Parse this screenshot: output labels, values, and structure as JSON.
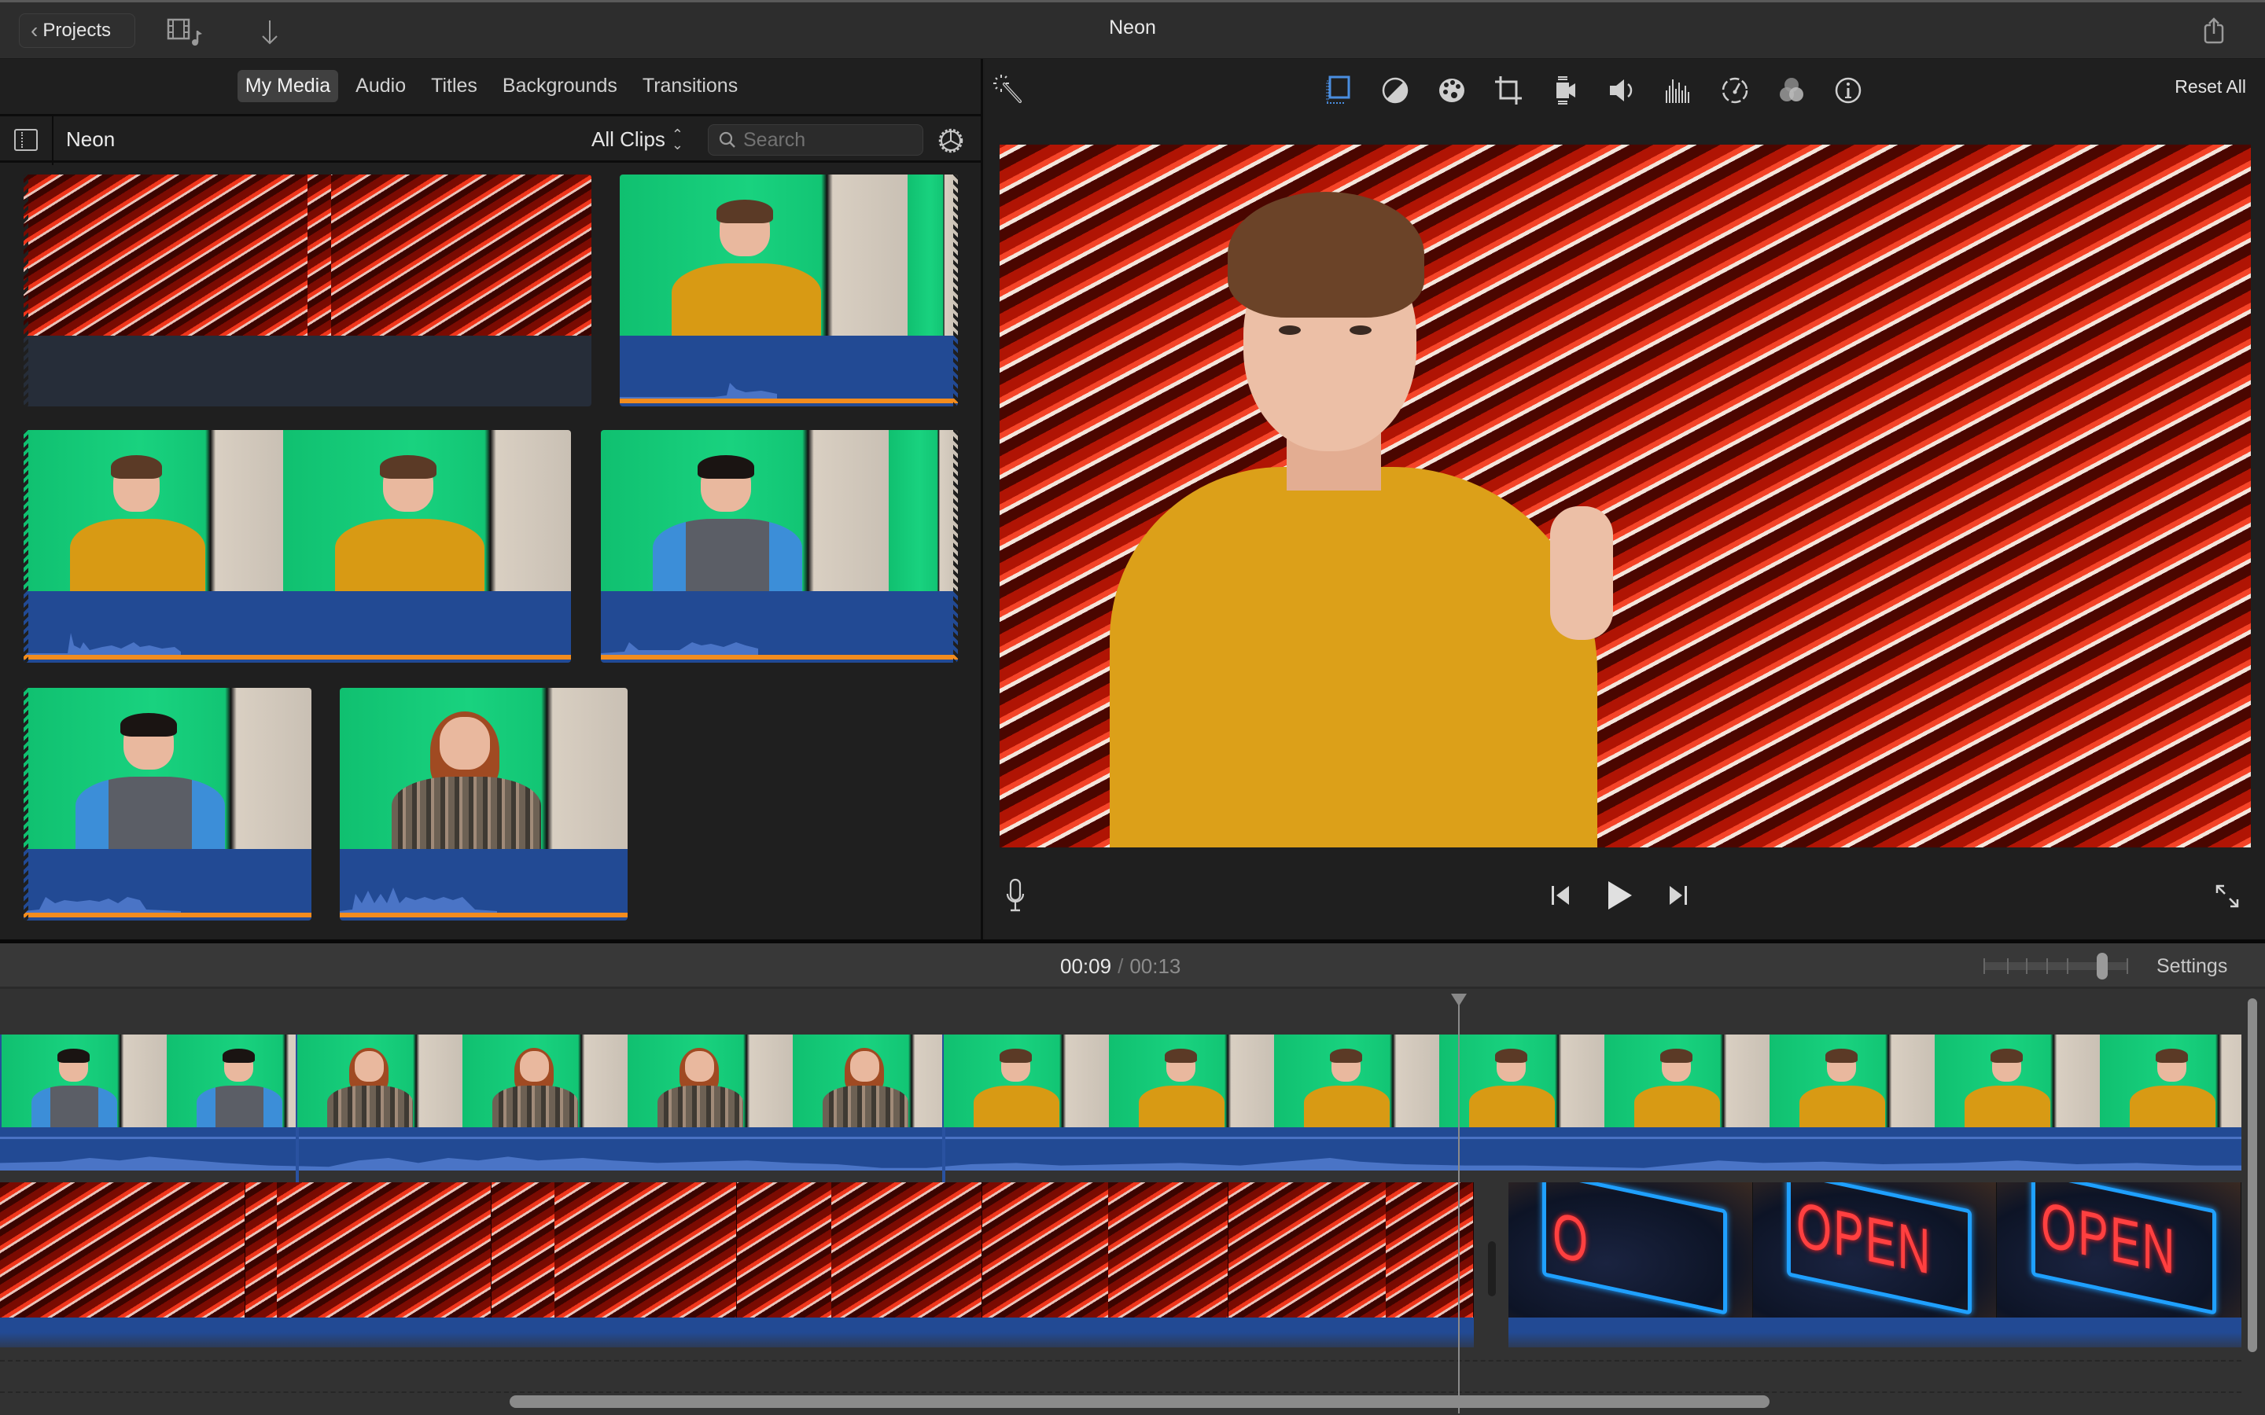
{
  "window": {
    "title": "Neon",
    "projects_button": "Projects",
    "icons": [
      "media-browser-icon",
      "import-icon",
      "share-icon"
    ]
  },
  "browser": {
    "tabs": [
      {
        "label": "My Media",
        "active": true
      },
      {
        "label": "Audio",
        "active": false
      },
      {
        "label": "Titles",
        "active": false
      },
      {
        "label": "Backgrounds",
        "active": false
      },
      {
        "label": "Transitions",
        "active": false
      }
    ],
    "library_name": "Neon",
    "filter": "All Clips",
    "search_placeholder": "Search",
    "search_value": "",
    "clips": [
      {
        "name": "neon-background-clip",
        "kind": "neon",
        "has_audio": false
      },
      {
        "name": "yellow-sweater-thumbsup-clip",
        "kind": "yellow",
        "has_audio": true
      },
      {
        "name": "yellow-sweater-talking-clip",
        "kind": "yellow",
        "has_audio": true
      },
      {
        "name": "henley-shirt-clip-1",
        "kind": "blue",
        "has_audio": true
      },
      {
        "name": "henley-shirt-clip-2",
        "kind": "blue",
        "has_audio": true
      },
      {
        "name": "plaid-shirt-clip",
        "kind": "plaid",
        "has_audio": true
      }
    ]
  },
  "viewer": {
    "toolbar": [
      {
        "name": "video-overlay-icon",
        "selected": true
      },
      {
        "name": "color-balance-icon",
        "selected": false
      },
      {
        "name": "color-correction-icon",
        "selected": false
      },
      {
        "name": "crop-icon",
        "selected": false
      },
      {
        "name": "stabilization-icon",
        "selected": false
      },
      {
        "name": "volume-icon",
        "selected": false
      },
      {
        "name": "noise-reduction-equalizer-icon",
        "selected": false
      },
      {
        "name": "speed-icon",
        "selected": false
      },
      {
        "name": "clip-filter-icon",
        "selected": false
      },
      {
        "name": "info-icon",
        "selected": false
      }
    ],
    "reset_all": "Reset All"
  },
  "timeline": {
    "current_time": "00:09",
    "separator": "/",
    "total_time": "00:13",
    "settings_label": "Settings",
    "zoom_level": 0.82,
    "playhead_fraction": 0.69,
    "video_clips": [
      {
        "kind": "blue",
        "frames": 2
      },
      {
        "kind": "plaid",
        "frames": 4
      },
      {
        "kind": "yellow",
        "frames": 8
      }
    ],
    "background_clips": [
      {
        "label": "neon-lines",
        "frames": 6
      },
      {
        "label": "open-sign",
        "frames": 3,
        "sign_text": "OPEN"
      }
    ]
  },
  "colors": {
    "accent_blue": "#4a8ee0",
    "audio_blue": "#224a94",
    "audio_orange": "#f28c1e",
    "green_screen": "#19d27f"
  }
}
